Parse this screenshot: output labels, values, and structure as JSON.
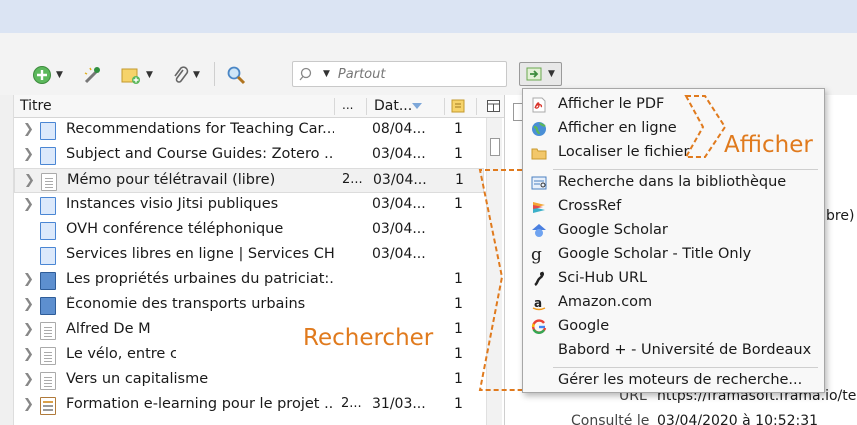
{
  "toolbar": {
    "search_placeholder": "Partout"
  },
  "columns": {
    "title": "Titre",
    "creator": "...",
    "date": "Dat..."
  },
  "rows": [
    {
      "title": "Recommendations for Teaching Car...",
      "creator": "",
      "date": "08/04...",
      "notes": "1",
      "type": "web"
    },
    {
      "title": "Subject and Course Guides: Zotero ...",
      "creator": "",
      "date": "03/04...",
      "notes": "1",
      "type": "web"
    },
    {
      "title": "Mémo pour télétravail (libre)",
      "creator": "2...",
      "date": "03/04...",
      "notes": "1",
      "type": "doc"
    },
    {
      "title": "Instances visio Jitsi publiques",
      "creator": "",
      "date": "03/04...",
      "notes": "1",
      "type": "web"
    },
    {
      "title": "OVH conférence téléphonique",
      "creator": "",
      "date": "03/04...",
      "notes": "",
      "type": "web"
    },
    {
      "title": "Services libres en ligne | Services CH...",
      "creator": "",
      "date": "03/04...",
      "notes": "",
      "type": "web"
    },
    {
      "title": "Les propriétés urbaines du patriciat:...",
      "creator": "",
      "date": "",
      "notes": "1",
      "type": "book"
    },
    {
      "title": "Économie des transports urbains",
      "creator": "",
      "date": "",
      "notes": "1",
      "type": "book"
    },
    {
      "title": "Alfred De M",
      "creator": "",
      "date": "",
      "notes": "1",
      "type": "doc"
    },
    {
      "title": "Le vélo, entre c",
      "creator": "",
      "date": "",
      "notes": "1",
      "type": "doc"
    },
    {
      "title": "Vers un capitalisme",
      "creator": "",
      "date": "",
      "notes": "1",
      "type": "doc"
    },
    {
      "title": "Formation e-learning pour le projet ...",
      "creator": "2...",
      "date": "31/03...",
      "notes": "1",
      "type": "report"
    }
  ],
  "menu": {
    "items": [
      {
        "label": "Afficher le PDF",
        "icon": "pdf-icon"
      },
      {
        "label": "Afficher en ligne",
        "icon": "globe-icon"
      },
      {
        "label": "Localiser le fichier",
        "icon": "folder-icon"
      },
      {
        "label": "Recherche dans la bibliothèque",
        "icon": "library-search-icon"
      },
      {
        "label": "CrossRef",
        "icon": "crossref-icon"
      },
      {
        "label": "Google Scholar",
        "icon": "scholar-icon"
      },
      {
        "label": "Google Scholar - Title Only",
        "icon": "scholar-title-icon"
      },
      {
        "label": "Sci-Hub URL",
        "icon": "scihub-icon"
      },
      {
        "label": "Amazon.com",
        "icon": "amazon-icon"
      },
      {
        "label": "Google",
        "icon": "google-icon"
      },
      {
        "label": "Babord + - Université de Bordeaux",
        "icon": ""
      },
      {
        "label": "Gérer les moteurs de recherche...",
        "icon": ""
      }
    ]
  },
  "annotations": {
    "afficher": "Afficher",
    "rechercher": "Rechercher"
  },
  "right_pane": {
    "trailing": "bre)",
    "url_label": "URL",
    "url_value": "https://framasoft.frama.io/tele",
    "consulted_label": "Consulté le",
    "consulted_value": "03/04/2020 à 10:52:31"
  },
  "colors": {
    "accent": "#e07a1d",
    "topbar": "#dbe4f3"
  }
}
